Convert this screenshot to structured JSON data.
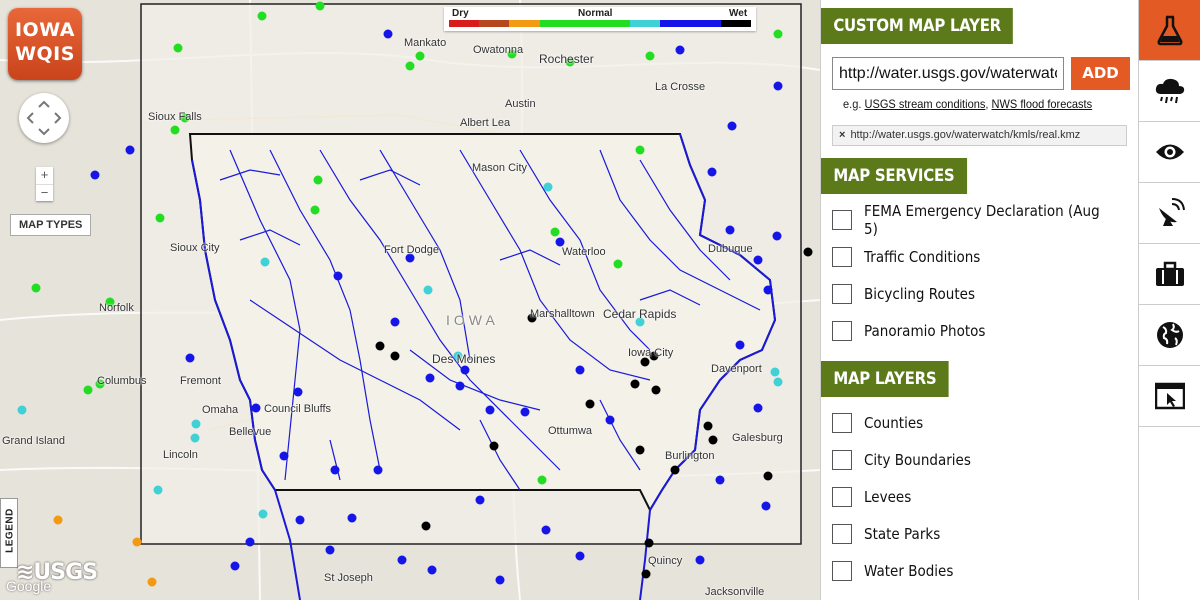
{
  "app": {
    "logo_line1": "IOWA",
    "logo_line2": "WQIS"
  },
  "map_controls": {
    "zoom_in": "+",
    "zoom_out": "−",
    "map_types": "MAP TYPES",
    "legend": "LEGEND",
    "usgs": "≋USGS",
    "google": "Google"
  },
  "scale_legend": {
    "dry": "Dry",
    "normal": "Normal",
    "wet": "Wet",
    "colors": [
      "#d81c1c",
      "#b5481d",
      "#f29a12",
      "#22dd22",
      "#22dd22",
      "#22dd22",
      "#3fd1d6",
      "#1515e8",
      "#1515e8",
      "#000000"
    ]
  },
  "map_labels": [
    {
      "text": "Mankato"
    },
    {
      "text": "Owatonna"
    },
    {
      "text": "Rochester"
    },
    {
      "text": "Sioux Falls"
    },
    {
      "text": "Austin"
    },
    {
      "text": "Albert Lea"
    },
    {
      "text": "La Crosse"
    },
    {
      "text": "Mason City"
    },
    {
      "text": "Sioux City"
    },
    {
      "text": "Fort Dodge"
    },
    {
      "text": "Waterloo"
    },
    {
      "text": "Dubuque"
    },
    {
      "text": "Norfolk"
    },
    {
      "text": "IOWA"
    },
    {
      "text": "Marshalltown"
    },
    {
      "text": "Cedar Rapids"
    },
    {
      "text": "Columbus"
    },
    {
      "text": "Fremont"
    },
    {
      "text": "Des Moines"
    },
    {
      "text": "Iowa City"
    },
    {
      "text": "Davenport"
    },
    {
      "text": "Omaha"
    },
    {
      "text": "Council Bluffs"
    },
    {
      "text": "Bellevue"
    },
    {
      "text": "Grand Island"
    },
    {
      "text": "Galesburg"
    },
    {
      "text": "Lincoln"
    },
    {
      "text": "Ottumwa"
    },
    {
      "text": "Burlington"
    },
    {
      "text": "St Joseph"
    },
    {
      "text": "Quincy"
    },
    {
      "text": "Jacksonville"
    }
  ],
  "custom_layer": {
    "title": "CUSTOM MAP LAYER",
    "url_value": "http://water.usgs.gov/waterwatch/kmls/real.kmz",
    "add_label": "ADD",
    "eg_prefix": "e.g.",
    "eg_link1": "USGS stream conditions",
    "eg_sep": ",",
    "eg_link2": "NWS flood forecasts",
    "chip_x": "×",
    "chip_text": "http://water.usgs.gov/waterwatch/kmls/real.kmz"
  },
  "map_services": {
    "title": "MAP SERVICES",
    "items": [
      {
        "label": "FEMA Emergency Declaration (Aug 5)"
      },
      {
        "label": "Traffic Conditions"
      },
      {
        "label": "Bicycling Routes"
      },
      {
        "label": "Panoramio Photos"
      }
    ]
  },
  "map_layers": {
    "title": "MAP LAYERS",
    "items": [
      {
        "label": "Counties"
      },
      {
        "label": "City Boundaries"
      },
      {
        "label": "Levees"
      },
      {
        "label": "State Parks"
      },
      {
        "label": "Water Bodies"
      }
    ]
  },
  "sidebar_icons": [
    "flask-icon",
    "rain-cloud-icon",
    "eye-icon",
    "satellite-dish-icon",
    "briefcase-icon",
    "globe-icon",
    "browser-cursor-icon"
  ]
}
